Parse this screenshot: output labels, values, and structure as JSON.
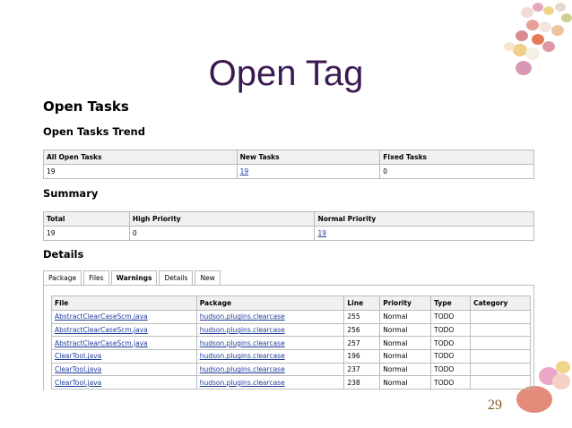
{
  "slide": {
    "title": "Open Tag",
    "number": "29"
  },
  "page": {
    "heading": "Open Tasks",
    "trend": {
      "heading": "Open Tasks Trend",
      "headers": [
        "All Open Tasks",
        "New Tasks",
        "Fixed Tasks"
      ],
      "values": [
        "19",
        "19",
        "0"
      ]
    },
    "summary": {
      "heading": "Summary",
      "headers": [
        "Total",
        "High Priority",
        "Normal Priority"
      ],
      "values": [
        "19",
        "0",
        "19"
      ]
    },
    "details": {
      "heading": "Details",
      "tabs": [
        "Package",
        "Files",
        "Warnings",
        "Details",
        "New"
      ],
      "active_tab": "Warnings",
      "headers": [
        "File",
        "Package",
        "Line",
        "Priority",
        "Type",
        "Category"
      ],
      "rows": [
        [
          "AbstractClearCaseScm.java",
          "hudson.plugins.clearcase",
          "255",
          "Normal",
          "TODO",
          ""
        ],
        [
          "AbstractClearCaseScm.java",
          "hudson.plugins.clearcase",
          "256",
          "Normal",
          "TODO",
          ""
        ],
        [
          "AbstractClearCaseScm.java",
          "hudson.plugins.clearcase",
          "257",
          "Normal",
          "TODO",
          ""
        ],
        [
          "ClearTool.java",
          "hudson.plugins.clearcase",
          "196",
          "Normal",
          "TODO",
          ""
        ],
        [
          "ClearTool.java",
          "hudson.plugins.clearcase",
          "237",
          "Normal",
          "TODO",
          ""
        ],
        [
          "ClearTool.java",
          "hudson.plugins.clearcase",
          "238",
          "Normal",
          "TODO",
          ""
        ]
      ]
    }
  }
}
